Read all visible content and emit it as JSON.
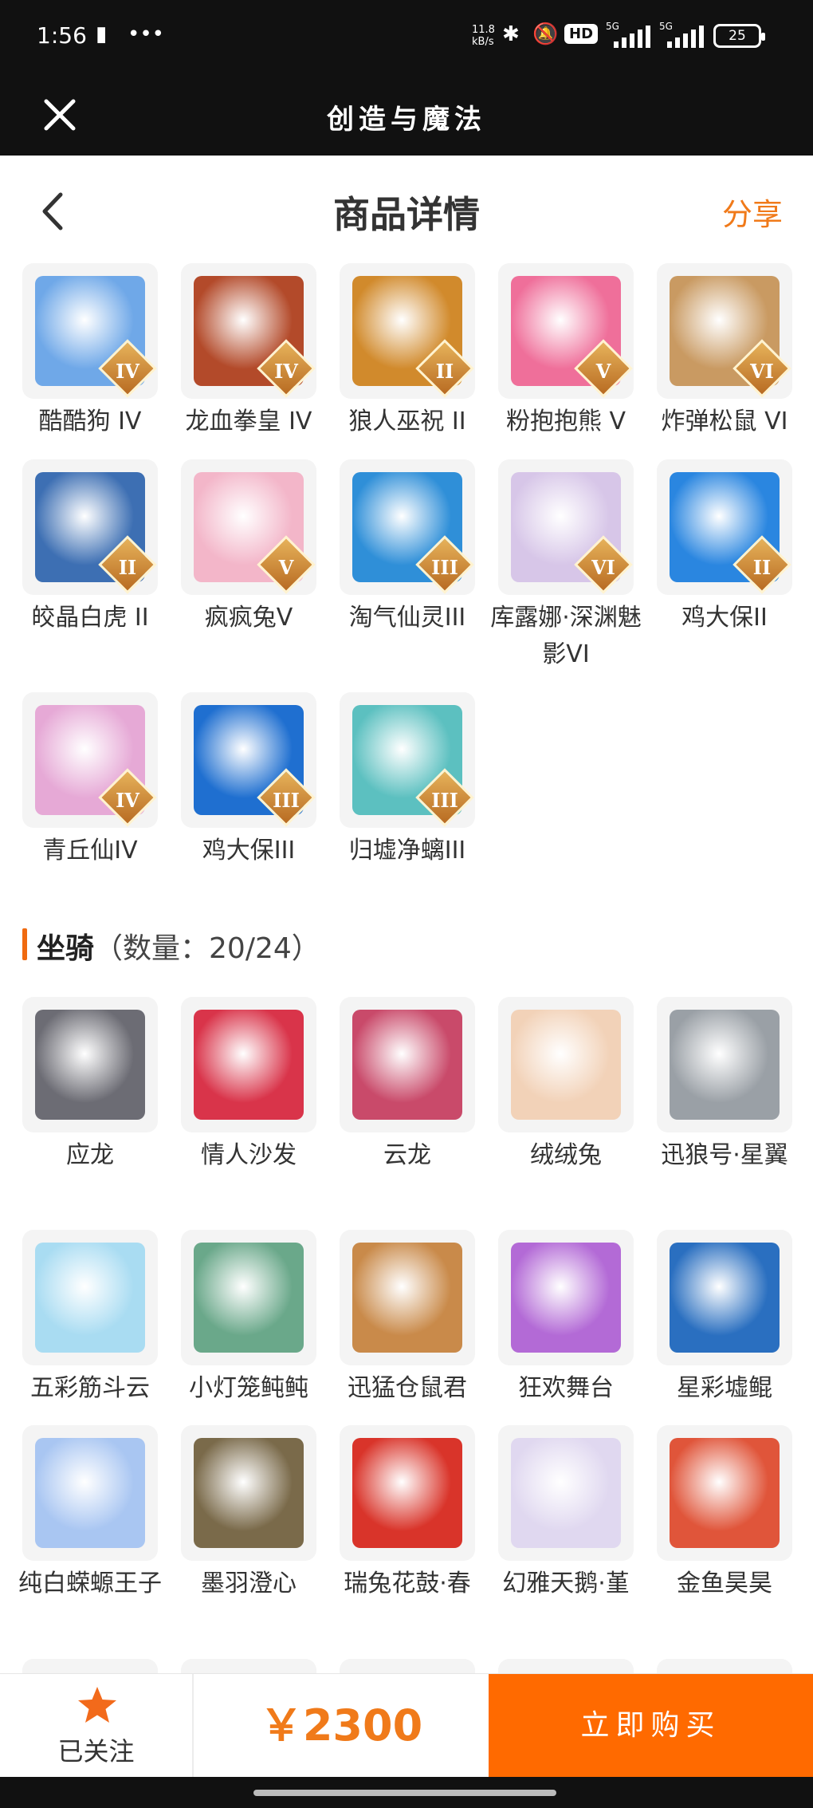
{
  "status_bar": {
    "time": "1:56",
    "net_speed": "11.8 kB/s",
    "network": "5G",
    "battery": "25"
  },
  "app": {
    "title": "创造与魔法"
  },
  "header": {
    "title": "商品详情",
    "share_label": "分享"
  },
  "pets": [
    {
      "name": "酷酷狗 IV",
      "rank": "IV",
      "color": "#6fa8e8"
    },
    {
      "name": "龙血拳皇 IV",
      "rank": "IV",
      "color": "#b34a2a"
    },
    {
      "name": "狼人巫祝 II",
      "rank": "II",
      "color": "#d18a2c"
    },
    {
      "name": "粉抱抱熊 V",
      "rank": "V",
      "color": "#ef6f9a"
    },
    {
      "name": "炸弹松鼠 VI",
      "rank": "VI",
      "color": "#c99a62"
    },
    {
      "name": "皎晶白虎 II",
      "rank": "II",
      "color": "#3d6fb3"
    },
    {
      "name": "疯疯兔V",
      "rank": "V",
      "color": "#f3b6c9"
    },
    {
      "name": "淘气仙灵III",
      "rank": "III",
      "color": "#2f8fd8"
    },
    {
      "name": "库露娜·深渊魅影VI",
      "rank": "VI",
      "color": "#d7c6e8"
    },
    {
      "name": "鸡大保II",
      "rank": "II",
      "color": "#2a86e0"
    },
    {
      "name": "青丘仙IV",
      "rank": "IV",
      "color": "#e6a9d6"
    },
    {
      "name": "鸡大保III",
      "rank": "III",
      "color": "#1f6fd0"
    },
    {
      "name": "归墟净螭III",
      "rank": "III",
      "color": "#5cc0c0"
    }
  ],
  "mounts_section": {
    "title": "坐骑",
    "count": "（数量：20/24）"
  },
  "mounts": [
    {
      "name": "应龙",
      "color": "#6c6c74"
    },
    {
      "name": "情人沙发",
      "color": "#d9344a"
    },
    {
      "name": "云龙",
      "color": "#c94a6a"
    },
    {
      "name": "绒绒兔",
      "color": "#f2d2b8"
    },
    {
      "name": "迅狼号·星翼",
      "color": "#9aa0a6"
    },
    {
      "name": "五彩筋斗云",
      "color": "#a9dcf2"
    },
    {
      "name": "小灯笼鲀鲀",
      "color": "#6aa88a"
    },
    {
      "name": "迅猛仓鼠君",
      "color": "#c98a4a"
    },
    {
      "name": "狂欢舞台",
      "color": "#b36ad6"
    },
    {
      "name": "星彩墟鲲",
      "color": "#2a6fc0"
    },
    {
      "name": "纯白蝾螈王子",
      "color": "#a9c6f2"
    },
    {
      "name": "墨羽澄心",
      "color": "#7a6a4a"
    },
    {
      "name": "瑞兔花鼓·春",
      "color": "#d9342a"
    },
    {
      "name": "幻雅天鹅·堇",
      "color": "#e0d8f0"
    },
    {
      "name": "金鱼昊昊",
      "color": "#e0553a"
    }
  ],
  "bottom": {
    "follow_label": "已关注",
    "price": "￥2300",
    "buy_label": "立即购买"
  },
  "colors": {
    "accent": "#ff6a00",
    "price": "#f07a1a",
    "dark_bar": "#111111"
  }
}
